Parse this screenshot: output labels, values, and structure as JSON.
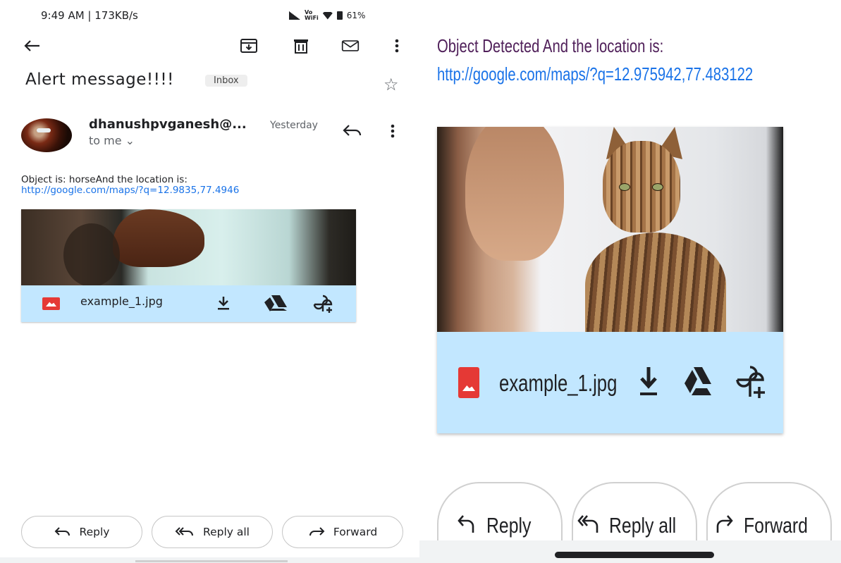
{
  "status_bar": {
    "time": "9:49 AM | 173KB/s",
    "volte": "Vo",
    "wifi_label": "WiFi",
    "battery": "61%"
  },
  "toolbar": {
    "icons": [
      "back-arrow-icon",
      "archive-icon",
      "delete-icon",
      "mark-unread-icon",
      "more-vert-icon"
    ]
  },
  "email": {
    "subject": "Alert message!!!!",
    "label": "Inbox",
    "sender": "dhanushpvganesh@...",
    "date": "Yesterday",
    "recipient": "to me",
    "body_text": "Object is: horseAnd the location is:",
    "body_link": "http://google.com/maps/?q=12.9835,77.4946",
    "attachment_name": "example_1.jpg"
  },
  "reply_actions": {
    "reply": "Reply",
    "reply_all": "Reply all",
    "forward": "Forward"
  },
  "zoomed_email": {
    "body_text": "Object Detected And the location is:",
    "body_link": "http://google.com/maps/?q=12.975942,77.483122",
    "attachment_name": "example_1.jpg"
  },
  "colors": {
    "link": "#1a73e8",
    "attachment_bar": "#c2e7ff",
    "image_badge": "#e53935",
    "zoomed_text": "#50205a"
  }
}
